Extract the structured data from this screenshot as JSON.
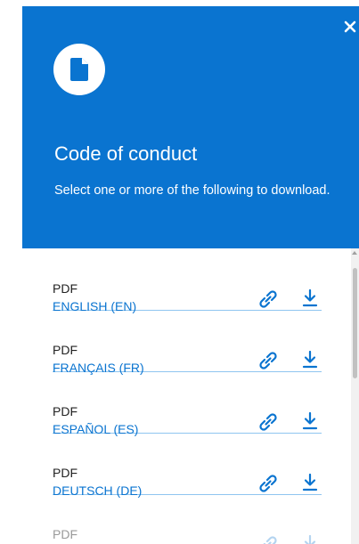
{
  "dialog": {
    "title": "Code of conduct",
    "subtitle": "Select one or more of the following to download.",
    "accent_color": "#0a74d0",
    "close_icon": "close-icon",
    "header_icon": "document-icon"
  },
  "documents": [
    {
      "format": "PDF",
      "language": "ENGLISH (EN)"
    },
    {
      "format": "PDF",
      "language": "FRANÇAIS (FR)"
    },
    {
      "format": "PDF",
      "language": "ESPAÑOL (ES)"
    },
    {
      "format": "PDF",
      "language": "DEUTSCH (DE)"
    },
    {
      "format": "PDF",
      "language": ""
    }
  ],
  "row_icons": {
    "link": "link-icon",
    "download": "download-icon"
  }
}
